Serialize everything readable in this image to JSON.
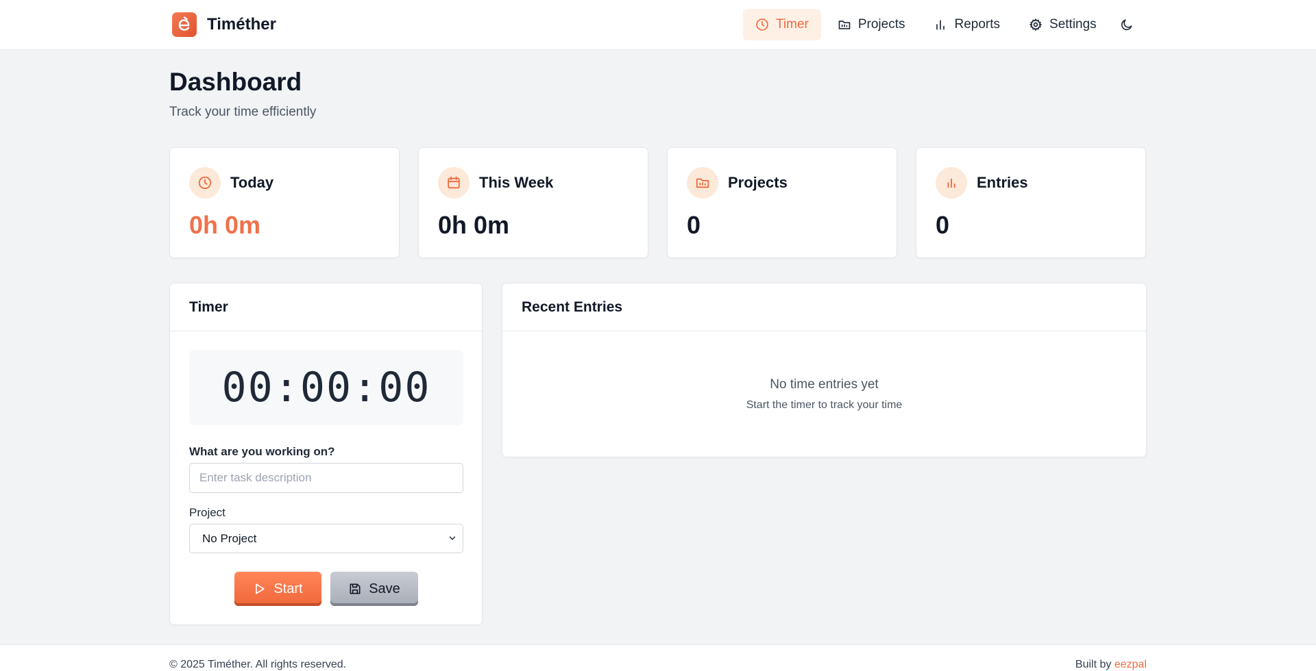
{
  "app": {
    "name": "Timéther"
  },
  "nav": {
    "items": [
      {
        "label": "Timer",
        "icon": "clock-icon",
        "active": true
      },
      {
        "label": "Projects",
        "icon": "folder-icon",
        "active": false
      },
      {
        "label": "Reports",
        "icon": "bar-chart-icon",
        "active": false
      },
      {
        "label": "Settings",
        "icon": "gear-icon",
        "active": false
      }
    ],
    "theme_toggle_icon": "moon-icon"
  },
  "page": {
    "title": "Dashboard",
    "subtitle": "Track your time efficiently"
  },
  "stats": [
    {
      "label": "Today",
      "value": "0h 0m",
      "icon": "clock-icon"
    },
    {
      "label": "This Week",
      "value": "0h 0m",
      "icon": "calendar-icon"
    },
    {
      "label": "Projects",
      "value": "0",
      "icon": "folder-icon"
    },
    {
      "label": "Entries",
      "value": "0",
      "icon": "bar-chart-icon"
    }
  ],
  "timer": {
    "title": "Timer",
    "display": "00:00:00",
    "task_label": "What are you working on?",
    "task_placeholder": "Enter task description",
    "task_value": "",
    "project_label": "Project",
    "project_selected": "No Project",
    "start_label": "Start",
    "save_label": "Save"
  },
  "recent": {
    "title": "Recent Entries",
    "empty_title": "No time entries yet",
    "empty_subtitle": "Start the timer to track your time"
  },
  "footer": {
    "copyright": "© 2025 Timéther. All rights reserved.",
    "built_by_prefix": "Built by",
    "built_by_link": "eezpal"
  },
  "colors": {
    "accent": "#ef6a3f",
    "accent_light": "#fde9d9",
    "background": "#f2f3f5"
  }
}
